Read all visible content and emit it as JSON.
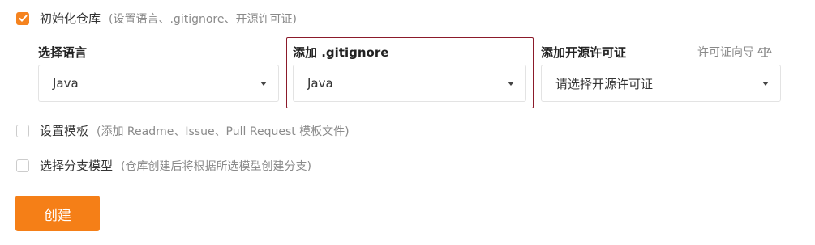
{
  "init_repo": {
    "checked": true,
    "label": "初始化仓库",
    "hint": "(设置语言、.gitignore、开源许可证)"
  },
  "fields": {
    "language": {
      "label": "选择语言",
      "value": "Java"
    },
    "gitignore": {
      "label": "添加 .gitignore",
      "value": "Java"
    },
    "license": {
      "label": "添加开源许可证",
      "value": "请选择开源许可证",
      "guide_label": "许可证向导"
    }
  },
  "template": {
    "checked": false,
    "label": "设置模板",
    "hint": "(添加 Readme、Issue、Pull Request 模板文件)"
  },
  "branch_model": {
    "checked": false,
    "label": "选择分支模型",
    "hint": "(仓库创建后将根据所选模型创建分支)"
  },
  "actions": {
    "create_label": "创建"
  },
  "colors": {
    "accent": "#f57f17",
    "highlight_border": "#8b1a2a"
  },
  "icons": {
    "checkbox_checked": "check-icon",
    "dropdown": "caret-down-icon",
    "license_guide": "scale-icon"
  }
}
